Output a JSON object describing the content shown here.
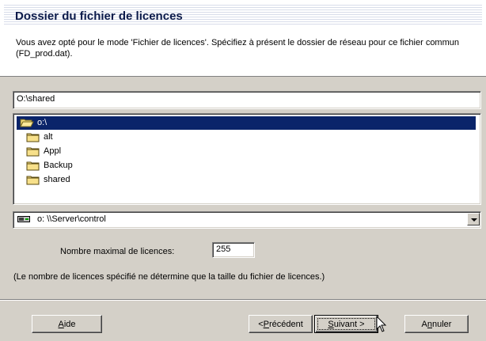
{
  "header": {
    "title": "Dossier du fichier de licences",
    "description": "Vous avez opté pour le mode 'Fichier de licences'. Spécifiez à présent le dossier de réseau pour ce fichier commun (FD_prod.dat)."
  },
  "path_field": {
    "value": "O:\\shared"
  },
  "folders": [
    {
      "label": "o:\\",
      "icon": "open-folder-icon",
      "selected": true
    },
    {
      "label": "alt",
      "icon": "folder-icon"
    },
    {
      "label": "Appl",
      "icon": "folder-icon"
    },
    {
      "label": "Backup",
      "icon": "folder-icon"
    },
    {
      "label": "shared",
      "icon": "folder-icon"
    }
  ],
  "drive_combo": {
    "value": "o:  \\\\Server\\control",
    "icon": "network-drive-icon"
  },
  "max_licenses": {
    "label": "Nombre maximal de licences:",
    "value": "255"
  },
  "note": "(Le nombre de licences spécifié ne détermine que la taille du fichier de licences.)",
  "buttons": {
    "help": {
      "mn": "A",
      "rest": "ide"
    },
    "back": {
      "pre": "<",
      "mn": "P",
      "rest": "récédent"
    },
    "next": {
      "mn": "S",
      "rest": "uivant >"
    },
    "cancel": {
      "pre": "A",
      "mn": "n",
      "rest": "nuler"
    }
  },
  "colors": {
    "selection": "#0a246a",
    "face": "#d4d0c8",
    "title": "#0b1a4a"
  }
}
